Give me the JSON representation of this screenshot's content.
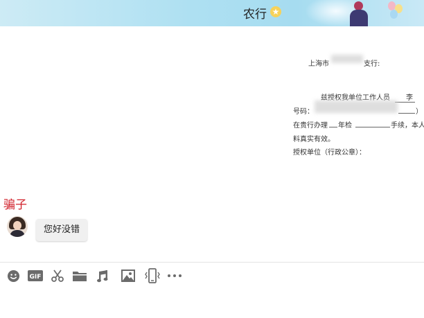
{
  "header": {
    "title": "农行",
    "star_icon": "star-icon"
  },
  "document": {
    "line1_left": "上海市",
    "line1_right": "支行:",
    "line2": "兹授权我单位工作人员",
    "line2_name": "李",
    "line3": "号码：",
    "line3_end": "）",
    "line4_a": "在贵行办理",
    "line4_b": "年检",
    "line4_c": "手续，本人",
    "line5": "料真实有效。",
    "line6": "授权单位（行政公章）："
  },
  "chat": {
    "sender": "骗子",
    "message": "您好没错"
  },
  "toolbar": {
    "icons": [
      "emoji-icon",
      "gif-icon",
      "scissors-icon",
      "folder-icon",
      "music-icon",
      "image-icon",
      "shake-icon",
      "more-icon"
    ],
    "gif_label": "GIF"
  },
  "colors": {
    "header_bg": "#aee0f2",
    "sender_name": "#d0202a",
    "bubble_bg": "#f0f0f0",
    "icon": "#6b6b6b"
  }
}
